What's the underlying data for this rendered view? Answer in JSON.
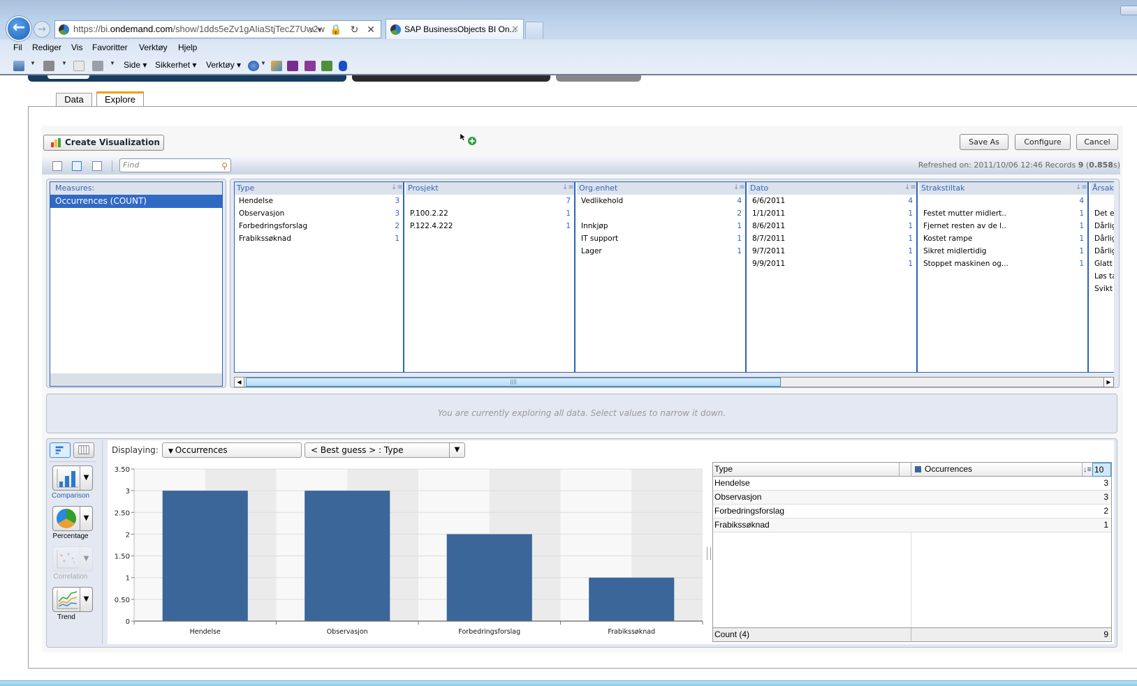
{
  "browser": {
    "url_prefix": "https://bi.",
    "url_domain": "ondemand.com",
    "url_path": "/show/1dds5eZv1gAIiaStjTecZ7Uw2w",
    "address_icons": "⌕▾ 🔒 ↻ ✕",
    "tab_title": "SAP BusinessObjects BI On...",
    "tab_close": "✕",
    "menu": [
      "Fil",
      "Rediger",
      "Vis",
      "Favoritter",
      "Verktøy",
      "Hjelp"
    ],
    "command_bar": {
      "side": "Side ▾",
      "sikkerhet": "Sikkerhet ▾",
      "verktoy": "Verktøy ▾"
    }
  },
  "page_tabs": {
    "data": "Data",
    "explore": "Explore"
  },
  "toolbar": {
    "create_visualization": "Create Visualization",
    "save_as": "Save As",
    "configure": "Configure",
    "cancel": "Cancel",
    "find_placeholder": "Find",
    "refreshed_label": "Refreshed on: 2011/10/06 12:46 Records ",
    "records": "9",
    "duration_open": " (",
    "duration": "0.858",
    "duration_close": "s)"
  },
  "measures": {
    "header": "Measures:",
    "selected": "Occurrences (COUNT)"
  },
  "facets": [
    {
      "name": "Type",
      "rows": [
        {
          "value": "Hendelse",
          "count": "3"
        },
        {
          "value": "Observasjon",
          "count": "3"
        },
        {
          "value": "Forbedringsforslag",
          "count": "2"
        },
        {
          "value": "Frabikssøknad",
          "count": "1"
        }
      ]
    },
    {
      "name": "Prosjekt",
      "rows": [
        {
          "value": "",
          "count": "7"
        },
        {
          "value": "P.100.2.22",
          "count": "1"
        },
        {
          "value": "P.122.4.222",
          "count": "1"
        }
      ]
    },
    {
      "name": "Org.enhet",
      "rows": [
        {
          "value": "Vedlikehold",
          "count": "4"
        },
        {
          "value": "",
          "count": "2"
        },
        {
          "value": "Innkjøp",
          "count": "1"
        },
        {
          "value": "IT support",
          "count": "1"
        },
        {
          "value": "Lager",
          "count": "1"
        }
      ]
    },
    {
      "name": "Dato",
      "rows": [
        {
          "value": "6/6/2011",
          "count": "4"
        },
        {
          "value": "1/1/2011",
          "count": "1"
        },
        {
          "value": "8/6/2011",
          "count": "1"
        },
        {
          "value": "8/7/2011",
          "count": "1"
        },
        {
          "value": "9/7/2011",
          "count": "1"
        },
        {
          "value": "9/9/2011",
          "count": "1"
        }
      ]
    },
    {
      "name": "Strakstiltak",
      "rows": [
        {
          "value": "",
          "count": "4"
        },
        {
          "value": "Festet mutter midlert..",
          "count": "1"
        },
        {
          "value": "Fjernet resten av de l..",
          "count": "1"
        },
        {
          "value": "Kostet rampe",
          "count": "1"
        },
        {
          "value": "Sikret midlertidig",
          "count": "1"
        },
        {
          "value": "Stoppet maskinen og...",
          "count": "1"
        }
      ]
    },
    {
      "name": "Årsak",
      "rows": [
        {
          "value": "",
          "count": ""
        },
        {
          "value": "Det er v",
          "count": ""
        },
        {
          "value": "Dårlig fe",
          "count": ""
        },
        {
          "value": "Dårlig m",
          "count": ""
        },
        {
          "value": "Dårlig r",
          "count": ""
        },
        {
          "value": "Glatt",
          "count": ""
        },
        {
          "value": "Løs tak",
          "count": ""
        },
        {
          "value": "Svikt i k",
          "count": ""
        }
      ]
    }
  ],
  "explore_message": "You are currently exploring all data. Select values to narrow it down.",
  "viz": {
    "types": [
      {
        "label": "Comparison",
        "state": "active"
      },
      {
        "label": "Percentage",
        "state": "normal"
      },
      {
        "label": "Correlation",
        "state": "disabled"
      },
      {
        "label": "Trend",
        "state": "normal"
      }
    ],
    "displaying_label": "Displaying:",
    "measure_select": "Occurrences",
    "dimension_select": "< Best guess > : Type",
    "accent_color": "#3a6699"
  },
  "chart_data": {
    "type": "bar",
    "title": "",
    "xlabel": "",
    "ylabel": "",
    "categories": [
      "Hendelse",
      "Observasjon",
      "Forbedringsforslag",
      "Frabikssøknad"
    ],
    "values": [
      3,
      3,
      2,
      1
    ],
    "series": [
      {
        "name": "Occurrences",
        "values": [
          3,
          3,
          2,
          1
        ]
      }
    ],
    "ylim": [
      0,
      3.5
    ],
    "yticks": [
      "0",
      "0.50",
      "1",
      "1.50",
      "2",
      "2.50",
      "3",
      "3.50"
    ],
    "ytick_values": [
      0,
      0.5,
      1,
      1.5,
      2,
      2.5,
      3,
      3.5
    ],
    "grid": true,
    "legend": "none",
    "bar_color": "#3a6699"
  },
  "table": {
    "col_type": "Type",
    "col_measure": "Occurrences",
    "top_n": "10",
    "rows": [
      {
        "name": "Hendelse",
        "value": "3"
      },
      {
        "name": "Observasjon",
        "value": "3"
      },
      {
        "name": "Forbedringsforslag",
        "value": "2"
      },
      {
        "name": "Frabikssøknad",
        "value": "1"
      }
    ],
    "footer_label": "Count (4)",
    "footer_value": "9"
  }
}
